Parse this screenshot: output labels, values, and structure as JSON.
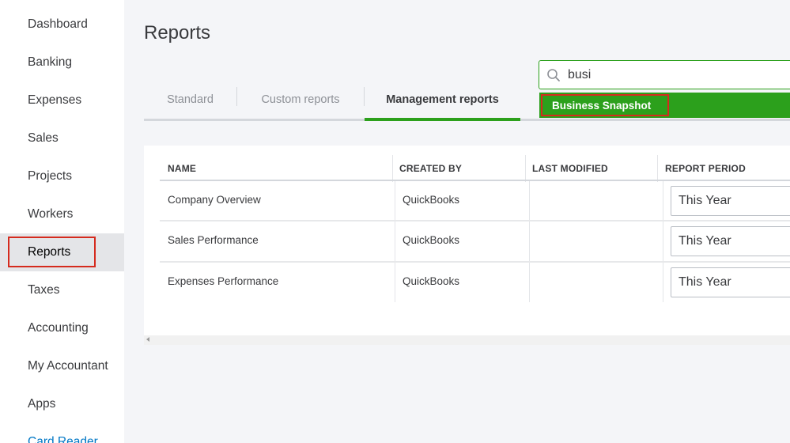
{
  "sidebar": {
    "items": [
      {
        "label": "Dashboard"
      },
      {
        "label": "Banking"
      },
      {
        "label": "Expenses"
      },
      {
        "label": "Sales"
      },
      {
        "label": "Projects"
      },
      {
        "label": "Workers"
      },
      {
        "label": "Reports"
      },
      {
        "label": "Taxes"
      },
      {
        "label": "Accounting"
      },
      {
        "label": "My Accountant"
      },
      {
        "label": "Apps"
      },
      {
        "label": "Card Reader"
      }
    ],
    "active": "Reports"
  },
  "page": {
    "title": "Reports"
  },
  "tabs": [
    {
      "label": "Standard"
    },
    {
      "label": "Custom reports"
    },
    {
      "label": "Management reports"
    }
  ],
  "search": {
    "value": "busi",
    "suggestion": "Business Snapshot"
  },
  "table": {
    "headers": [
      "NAME",
      "CREATED BY",
      "LAST MODIFIED",
      "REPORT PERIOD"
    ],
    "rows": [
      {
        "name": "Company Overview",
        "created_by": "QuickBooks",
        "last_modified": "",
        "period": "This Year"
      },
      {
        "name": "Sales Performance",
        "created_by": "QuickBooks",
        "last_modified": "",
        "period": "This Year"
      },
      {
        "name": "Expenses Performance",
        "created_by": "QuickBooks",
        "last_modified": "",
        "period": "This Year"
      }
    ]
  },
  "colors": {
    "accent_green": "#2ca01c",
    "highlight_red": "#d52b1e",
    "link_blue": "#0077c5"
  }
}
